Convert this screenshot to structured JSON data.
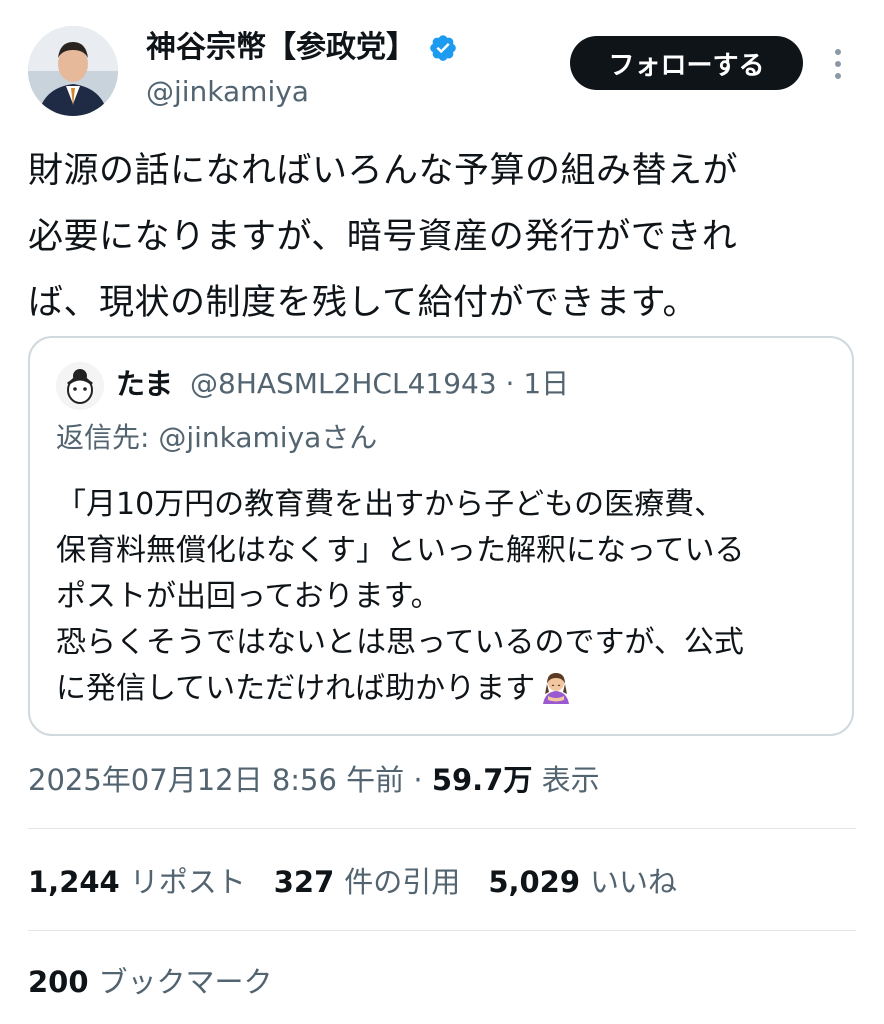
{
  "author": {
    "name": "神谷宗幣【参政党】",
    "handle": "@jinkamiya",
    "verified_icon": "verified-badge-icon",
    "verified_color": "#1d9bf0"
  },
  "follow_button": {
    "label": "フォローする"
  },
  "tweet": {
    "lines": [
      "財源の話になればいろんな予算の組み替えが",
      "必要になりますが、暗号資産の発行ができれ",
      "ば、現状の制度を残して給付ができます。"
    ]
  },
  "quote": {
    "name": "たま",
    "handle_time": "@8HASML2HCL41943 · 1日",
    "reply_to": "返信先: @jinkamiyaさん",
    "lines": [
      "「月10万円の教育費を出すから子どもの医療費、",
      "保育料無償化はなくす」といった解釈になっている",
      "ポストが出回っております。",
      "恐らくそうではないとは思っているのですが、公式",
      "に発信していただければ助かります"
    ],
    "emoji": "person-bowing-emoji"
  },
  "meta": {
    "datetime": "2025年07月12日 8:56 午前 · ",
    "views_count": "59.7万",
    "views_label": "表示"
  },
  "stats": {
    "reposts_count": "1,244",
    "reposts_label": "リポスト",
    "quotes_count": "327",
    "quotes_label": "件の引用",
    "likes_count": "5,029",
    "likes_label": "いいね",
    "bookmarks_count": "200",
    "bookmarks_label": "ブックマーク"
  },
  "colors": {
    "text": "#0f1419",
    "secondary": "#536471",
    "border": "#cfd9de",
    "button_bg": "#0f1419"
  }
}
